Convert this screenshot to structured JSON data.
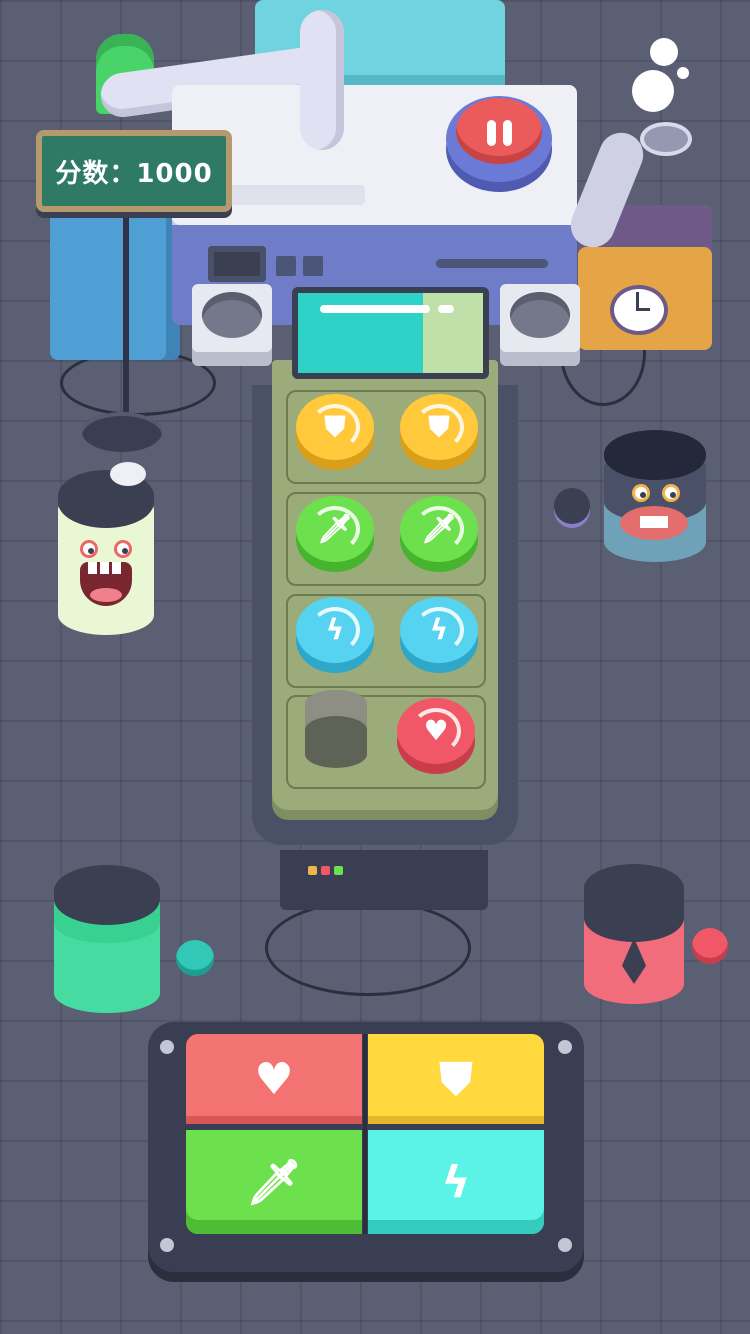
{
  "hud": {
    "score_text": "分数：1000"
  },
  "colors": {
    "background": "#5b5f74",
    "red": "#f05868",
    "yellow": "#ffd93d",
    "green": "#6de04d",
    "cyan": "#5af3e6"
  },
  "tray_tokens": [
    {
      "color": "yellow",
      "icon": "shield-icon",
      "symbol": "⛊"
    },
    {
      "color": "yellow",
      "icon": "shield-icon",
      "symbol": "⛊"
    },
    {
      "color": "green",
      "icon": "sword-icon",
      "symbol": "🗡"
    },
    {
      "color": "green",
      "icon": "sword-icon",
      "symbol": "🗡"
    },
    {
      "color": "blue",
      "icon": "lightning-icon",
      "symbol": "ϟ"
    },
    {
      "color": "blue",
      "icon": "lightning-icon",
      "symbol": "ϟ"
    },
    {
      "color": "gray",
      "icon": "empty-cylinder",
      "symbol": ""
    },
    {
      "color": "red",
      "icon": "heart-icon",
      "symbol": "♥"
    }
  ],
  "controller": {
    "heart_symbol": "♥",
    "shield_symbol": "⛊",
    "sword_symbol": "🗡",
    "lightning_symbol": "ϟ"
  }
}
